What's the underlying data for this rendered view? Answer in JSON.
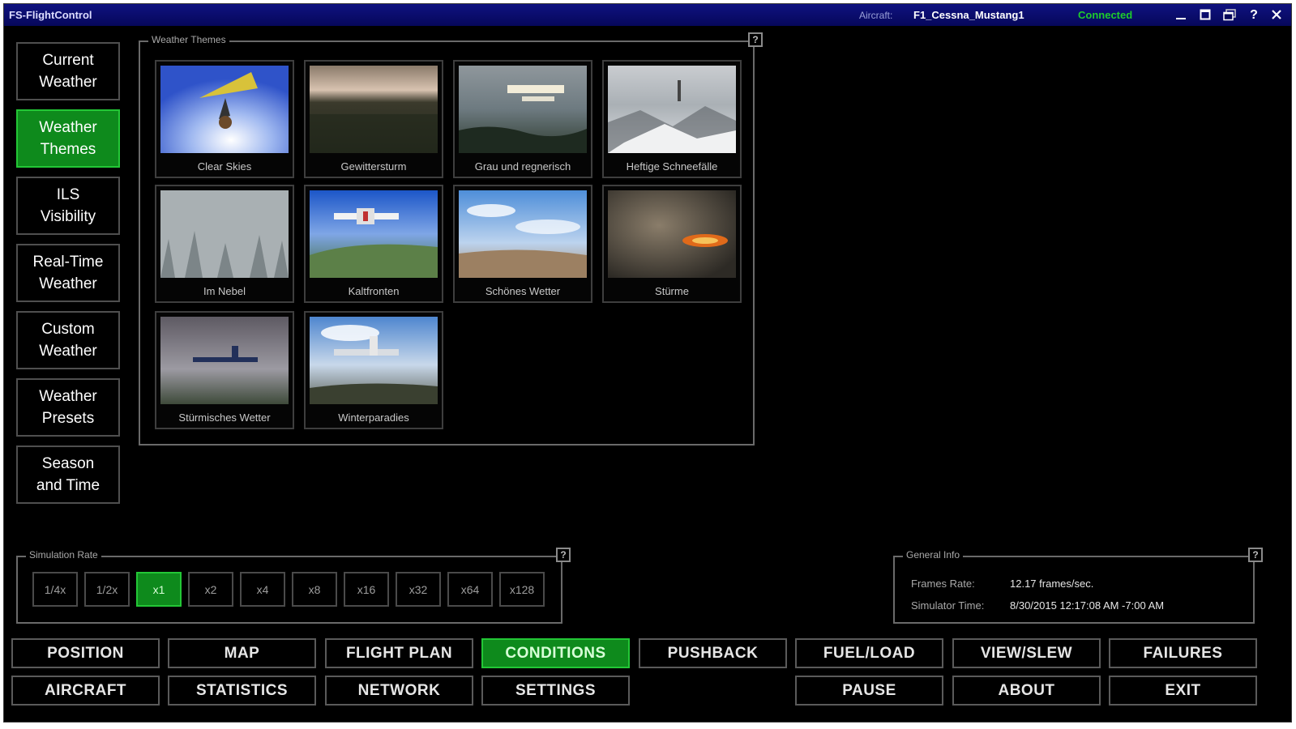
{
  "titlebar": {
    "app_title": "FS-FlightControl",
    "aircraft_label": "Aircraft:",
    "aircraft_name": "F1_Cessna_Mustang1",
    "status": "Connected",
    "status_color": "#1ecc2c"
  },
  "nav": {
    "items": [
      {
        "label": "Current\nWeather"
      },
      {
        "label": "Weather\nThemes"
      },
      {
        "label": "ILS\nVisibility"
      },
      {
        "label": "Real-Time\nWeather"
      },
      {
        "label": "Custom\nWeather"
      },
      {
        "label": "Weather\nPresets"
      },
      {
        "label": "Season\nand Time"
      }
    ],
    "active_index": 1
  },
  "themes": {
    "title": "Weather Themes",
    "help_label": "?",
    "items": [
      {
        "caption": "Clear Skies"
      },
      {
        "caption": "Gewittersturm"
      },
      {
        "caption": "Grau und regnerisch"
      },
      {
        "caption": "Heftige Schneefälle"
      },
      {
        "caption": "Im Nebel"
      },
      {
        "caption": "Kaltfronten"
      },
      {
        "caption": "Schönes Wetter"
      },
      {
        "caption": "Stürme"
      },
      {
        "caption": "Stürmisches Wetter"
      },
      {
        "caption": "Winterparadies"
      }
    ]
  },
  "sim_rate": {
    "title": "Simulation Rate",
    "help_label": "?",
    "options": [
      "1/4x",
      "1/2x",
      "x1",
      "x2",
      "x4",
      "x8",
      "x16",
      "x32",
      "x64",
      "x128"
    ],
    "active_index": 2
  },
  "general_info": {
    "title": "General Info",
    "help_label": "?",
    "frame_rate_label": "Frames Rate:",
    "frame_rate_value": "12.17 frames/sec.",
    "sim_time_label": "Simulator Time:",
    "sim_time_value": "8/30/2015 12:17:08 AM -7:00 AM"
  },
  "tabs": {
    "row1": [
      "POSITION",
      "MAP",
      "FLIGHT PLAN",
      "CONDITIONS",
      "PUSHBACK",
      "FUEL/LOAD",
      "VIEW/SLEW",
      "FAILURES"
    ],
    "row2_left": [
      "AIRCRAFT",
      "STATISTICS",
      "NETWORK",
      "SETTINGS"
    ],
    "row2_right": [
      "PAUSE",
      "ABOUT",
      "EXIT"
    ],
    "active": "CONDITIONS"
  },
  "colors": {
    "accent_active": "#0e8a1c",
    "accent_border": "#23c736",
    "titlebar": "#0f1280"
  }
}
